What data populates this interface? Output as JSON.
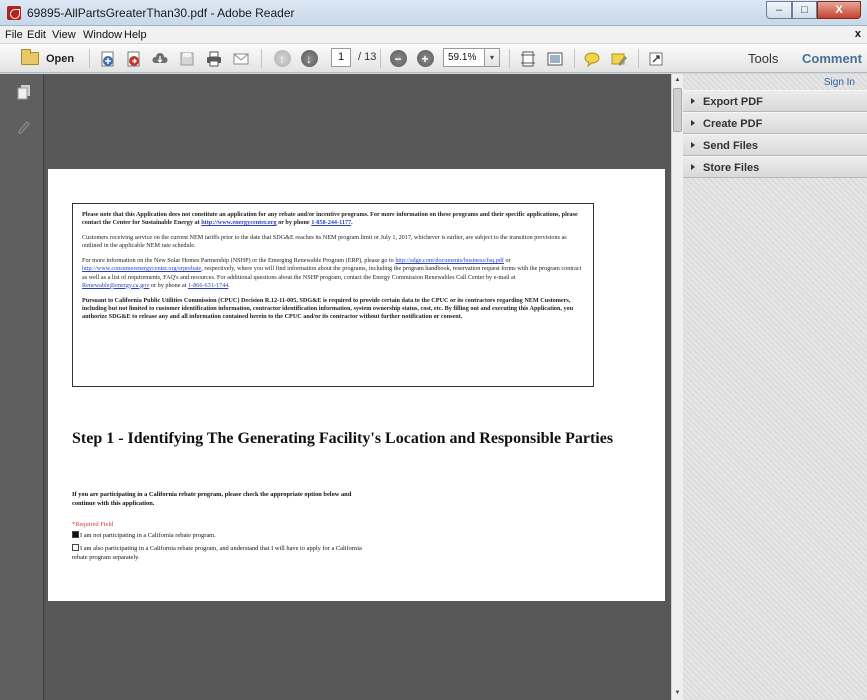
{
  "window": {
    "title": "69895-AllPartsGreaterThan30.pdf - Adobe Reader",
    "controls": {
      "minimize": "–",
      "maximize": "□",
      "close": "X"
    }
  },
  "menubar": {
    "items": [
      "File",
      "Edit",
      "View",
      "Window",
      "Help"
    ],
    "close": "x"
  },
  "toolbar": {
    "open_label": "Open",
    "page_current": "1",
    "page_total": "/ 13",
    "zoom_value": "59.1%",
    "zoom_dropdown": "▾",
    "tools_label": "Tools",
    "comment_label": "Comment",
    "icons": [
      "open-icon",
      "create-pdf-icon",
      "export-pdf-icon",
      "cloud-icon",
      "save-icon",
      "print-icon",
      "email-icon",
      "previous-page-icon",
      "next-page-icon",
      "zoom-out-icon",
      "zoom-in-icon",
      "fit-page-icon",
      "fit-width-icon",
      "comment-note-icon",
      "highlight-icon",
      "full-screen-icon"
    ]
  },
  "leftnav": {
    "icons": [
      "pages-thumbnail-icon",
      "signature-pen-icon"
    ]
  },
  "document": {
    "notice": {
      "p1_a": "Please note that this Application does not constitute an application for any rebate and/or incentive programs. For more information on these programs and their specific applications, please contact the Center for Sustainable Energy at ",
      "p1_link": "http://www.energycenter.org",
      "p1_b": " or by phone ",
      "p1_phone": "1-858-244-1177",
      "p1_c": ".",
      "p2": "Customers receiving service on the current NEM tariffs prior to the date that SDG&E reaches its NEM program limit or July 1, 2017, whichever is earlier, are subject to the transition provisions as outlined in the applicable NEM rate schedule.",
      "p3_a": "For more information on the New Solar Homes Partnership (NSHP) or the Emerging Renewable Program (ERP), please go to ",
      "p3_link1": "http://sdge.com/documents/business/fsq.pdf",
      "p3_b": " or ",
      "p3_link2": "http://www.consumerenergycenter.org/erprebate",
      "p3_c": ", respectively, where you will find information about the programs, including the program handbook, reservation request forms with the program contract as well as a list of requirements, FAQ's and resources. For additional questions about the NSHP program, contact the Energy Commission Renewables Call Center by e-mail at ",
      "p3_email": "Renewable@energy.ca.gov",
      "p3_d": " or by phone at ",
      "p3_phone": "1-866-631-1744",
      "p3_e": ".",
      "p4": "Pursuant to California Public Utilities Commission (CPUC) Decision R.12-11-005, SDG&E is required to provide certain data to the CPUC or its contractors regarding NEM Customers, including but not limited to customer identification information, contractor identification information, system ownership status, cost, etc. By filling out and executing this Application, you authorize SDG&E to release any and all information contained herein to the CPUC and/or its contractor without further notification or consent."
    },
    "step_title": "Step 1 - Identifying The Generating Facility's Location and Responsible Parties",
    "instruction": "If you are participating in a California rebate program, please check the appropriate option below and continue with this application.",
    "required_field": "*Required Field",
    "option1": "I am not participating in a California rebate program.",
    "option2": "I am also participating in a California rebate program, and understand that I will have to apply for a California rebate program separately."
  },
  "rightpane": {
    "sign_in": "Sign In",
    "panels": [
      "Export PDF",
      "Create PDF",
      "Send Files",
      "Store Files"
    ]
  },
  "colors": {
    "doc_background": "#575757",
    "comment_accent": "#4a6f95",
    "link": "#2a3fc8",
    "required": "#d43b3b",
    "close_button": "#c5432d"
  }
}
